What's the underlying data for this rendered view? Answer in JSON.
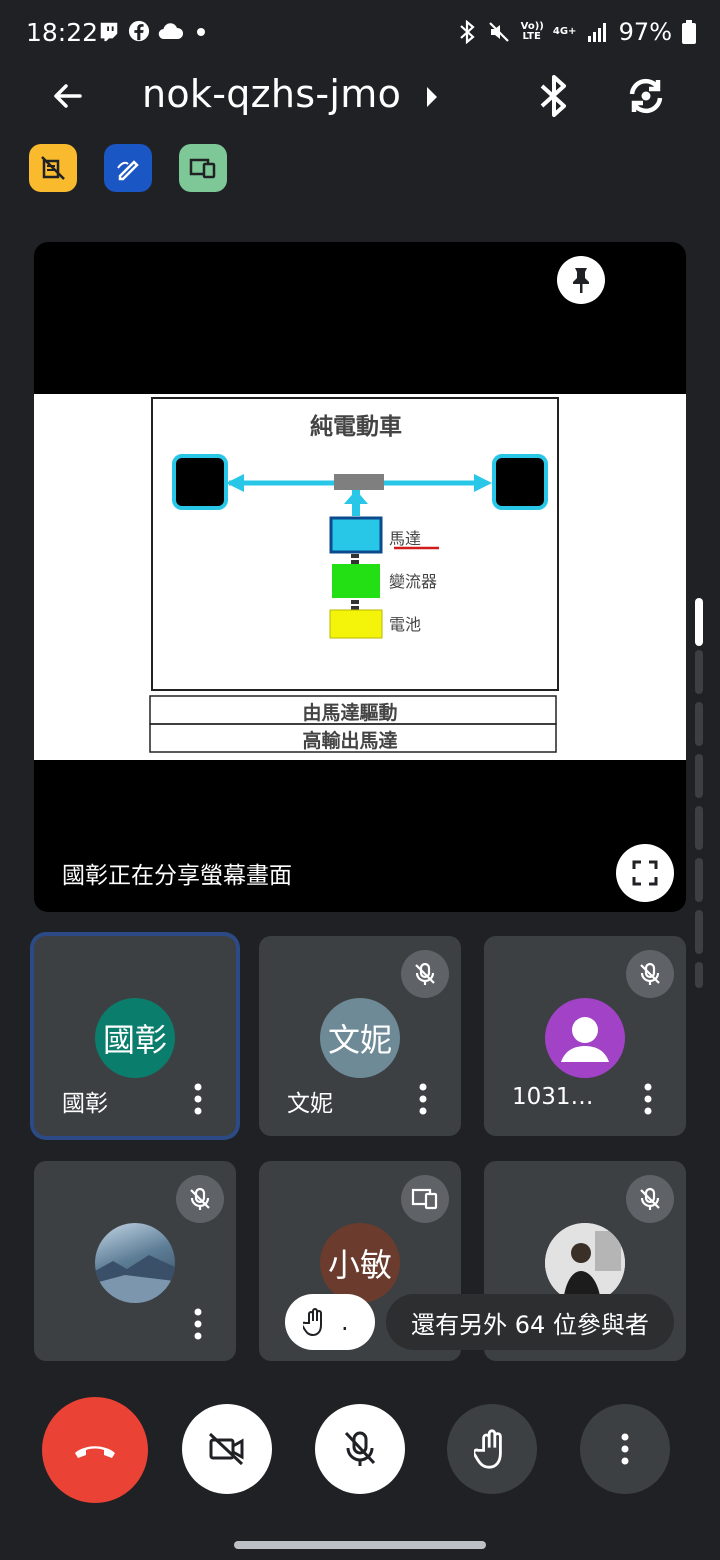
{
  "status_bar": {
    "time": "18:22",
    "volte": "Vo)) LTE",
    "net": "4G+",
    "battery": "97%"
  },
  "header": {
    "meeting_code": "nok-qzhs-jmo"
  },
  "chips": [
    {
      "color": "#f9bb2d",
      "icon": "no-recording-icon"
    },
    {
      "color": "#1a56c4",
      "icon": "whiteboard-icon"
    },
    {
      "color": "#7dc896",
      "icon": "devices-icon"
    }
  ],
  "share": {
    "caption": "國彰正在分享螢幕畫面",
    "slide": {
      "title": "純電動車",
      "motor": "馬達",
      "inverter": "變流器",
      "battery": "電池",
      "footer1": "由馬達驅動",
      "footer2": "高輸出馬達"
    }
  },
  "participants": [
    {
      "name": "國彰",
      "avatar_text": "國彰",
      "avatar_color": "#0b7d6c",
      "muted": false,
      "active": true
    },
    {
      "name": "文妮",
      "avatar_text": "文妮",
      "avatar_color": "#6d8a96",
      "muted": true,
      "active": false
    },
    {
      "name": "1031…",
      "avatar_text": "",
      "avatar_color": "#a142c7",
      "muted": true,
      "active": false
    },
    {
      "name": "",
      "avatar_text": "",
      "avatar_color": "#5d7d96",
      "muted": true,
      "active": false
    },
    {
      "name": "",
      "avatar_text": "小敏",
      "avatar_color": "#6b3c2d",
      "muted": false,
      "active": false
    },
    {
      "name": "",
      "avatar_text": "",
      "avatar_color": "#c9c9c9",
      "muted": true,
      "active": false
    }
  ],
  "overlay": {
    "hand_count": ".",
    "others_text": "還有另外 64 位參與者"
  },
  "controls": {
    "end_call_color": "#ea4335"
  }
}
